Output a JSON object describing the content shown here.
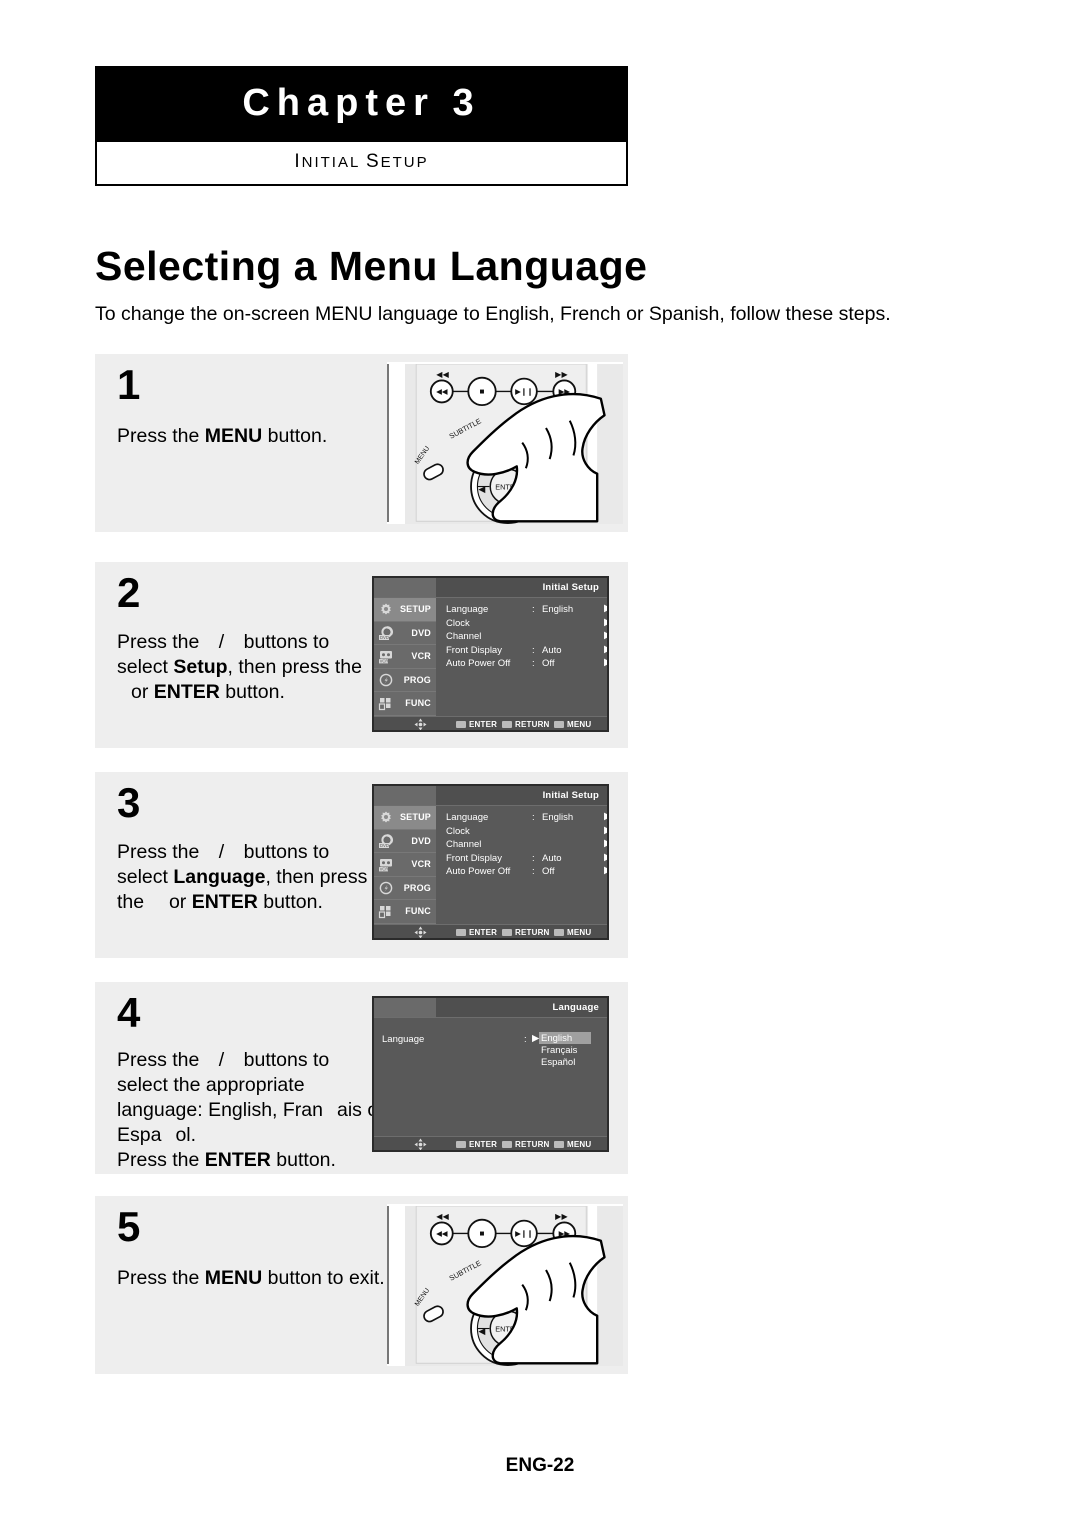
{
  "chapter": {
    "title": "Chapter 3",
    "subtitle_lead": "I",
    "subtitle_rest": "NITIAL ",
    "subtitle_lead2": "S",
    "subtitle_rest2": "ETUP"
  },
  "page": {
    "title": "Selecting a Menu Language",
    "intro": "To change the on-screen MENU language to English, French or Spanish, follow these steps.",
    "footer": "ENG-22"
  },
  "steps": [
    {
      "number": "1",
      "lines": [
        {
          "parts": [
            {
              "t": "Press the "
            },
            {
              "t": "MENU",
              "b": true
            },
            {
              "t": " button."
            }
          ]
        }
      ],
      "illustration": "remote"
    },
    {
      "number": "2",
      "lines": [
        {
          "parts": [
            {
              "t": "Press the "
            },
            {
              "gap": true
            },
            {
              "t": "/"
            },
            {
              "gap": true
            },
            {
              "t": " buttons to"
            }
          ]
        },
        {
          "parts": [
            {
              "t": "select "
            },
            {
              "t": "Setup",
              "b": true
            },
            {
              "t": ", then press the"
            }
          ]
        },
        {
          "parts": [
            {
              "gap": true
            },
            {
              "t": "or "
            },
            {
              "t": "ENTER",
              "b": true
            },
            {
              "t": " button."
            }
          ]
        }
      ],
      "illustration": "osd-initial-setup"
    },
    {
      "number": "3",
      "lines": [
        {
          "parts": [
            {
              "t": "Press the "
            },
            {
              "gap": true
            },
            {
              "t": "/"
            },
            {
              "gap": true
            },
            {
              "t": " buttons to"
            }
          ]
        },
        {
          "parts": [
            {
              "t": "select "
            },
            {
              "t": "Language",
              "b": true
            },
            {
              "t": ", then press"
            }
          ]
        },
        {
          "parts": [
            {
              "t": "the "
            },
            {
              "gap": true
            },
            {
              "t": " or "
            },
            {
              "t": "ENTER",
              "b": true
            },
            {
              "t": " button."
            }
          ]
        }
      ],
      "illustration": "osd-initial-setup"
    },
    {
      "number": "4",
      "lines": [
        {
          "parts": [
            {
              "t": "Press the "
            },
            {
              "gap": true
            },
            {
              "t": "/"
            },
            {
              "gap": true
            },
            {
              "t": " buttons to"
            }
          ]
        },
        {
          "parts": [
            {
              "t": "select the appropriate"
            }
          ]
        },
        {
          "parts": [
            {
              "t": "language: English, Fran"
            },
            {
              "gap": true
            },
            {
              "t": "ais or"
            }
          ]
        },
        {
          "parts": [
            {
              "t": "Espa"
            },
            {
              "gap": true
            },
            {
              "t": "ol."
            }
          ]
        },
        {
          "parts": [
            {
              "t": "Press the "
            },
            {
              "t": "ENTER",
              "b": true
            },
            {
              "t": " button."
            }
          ]
        }
      ],
      "illustration": "osd-language"
    },
    {
      "number": "5",
      "lines": [
        {
          "parts": [
            {
              "t": "Press the "
            },
            {
              "t": "MENU",
              "b": true
            },
            {
              "t": " button to exit."
            }
          ]
        }
      ],
      "illustration": "remote"
    }
  ],
  "osd_initial_setup": {
    "title": "Initial Setup",
    "sidebar": [
      {
        "label": "SETUP",
        "icon": "gear-icon",
        "active": true
      },
      {
        "label": "DVD",
        "icon": "disc-icon",
        "active": false
      },
      {
        "label": "VCR",
        "icon": "cassette-icon",
        "active": false
      },
      {
        "label": "PROG",
        "icon": "prog-icon",
        "active": false
      },
      {
        "label": "FUNC",
        "icon": "func-icon",
        "active": false
      }
    ],
    "rows": [
      {
        "label": "Language",
        "colon": ":",
        "value": "English",
        "arrow": "▶"
      },
      {
        "label": "Clock",
        "colon": "",
        "value": "",
        "arrow": "▶"
      },
      {
        "label": "Channel",
        "colon": "",
        "value": "",
        "arrow": "▶"
      },
      {
        "label": "Front Display",
        "colon": ":",
        "value": "Auto",
        "arrow": "▶"
      },
      {
        "label": "Auto Power Off",
        "colon": ":",
        "value": "Off",
        "arrow": "▶"
      }
    ],
    "footer": [
      {
        "label": "ENTER",
        "icon": "enter-icon"
      },
      {
        "label": "RETURN",
        "icon": "return-icon"
      },
      {
        "label": "MENU",
        "icon": "menu-icon"
      }
    ]
  },
  "osd_language": {
    "title": "Language",
    "label": "Language",
    "colon": ":",
    "cursor": "▶",
    "options": [
      {
        "label": "English",
        "selected": true
      },
      {
        "label": "Français",
        "selected": false
      },
      {
        "label": "Español",
        "selected": false
      }
    ],
    "footer": [
      {
        "label": "ENTER",
        "icon": "enter-icon"
      },
      {
        "label": "RETURN",
        "icon": "return-icon"
      },
      {
        "label": "MENU",
        "icon": "menu-icon"
      }
    ]
  },
  "remote": {
    "buttons": {
      "rewind": "◀◀",
      "forward": "▶▶",
      "skip_back": "◀◀",
      "stop": "■",
      "play_pause": "▶❙❙",
      "skip_forward": "▶▶"
    },
    "labels": {
      "subtitle": "SUBTITLE",
      "menu": "MENU",
      "enter": "ENTER",
      "left_arrow": "◀",
      "right_arrow": "▶"
    }
  },
  "colors": {
    "panel_bg": "#eeeeee",
    "osd_bg": "#595959",
    "osd_sidebar": "#6a6a6a",
    "osd_active": "#8a8a8a",
    "header_bar": "#000000"
  }
}
